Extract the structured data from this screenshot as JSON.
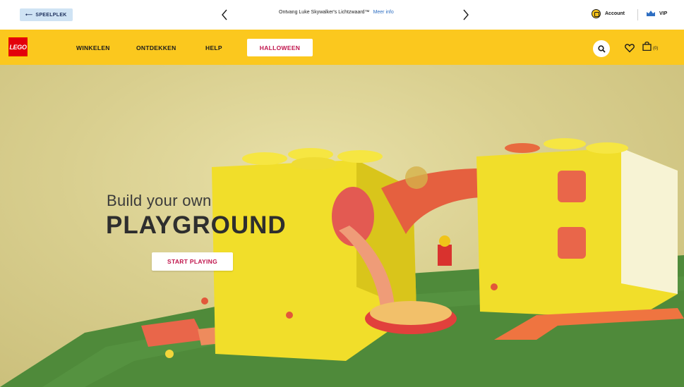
{
  "utility": {
    "speelplek_label": "SPEELPLEK",
    "promo_text": "Ontvang Luke Skywalker's Lichtzwaard™",
    "promo_link": "Meer info",
    "account_label": "Account",
    "vip_label": "VIP"
  },
  "nav": {
    "logo_text": "LEGO",
    "items": [
      "WINKELEN",
      "ONTDEKKEN",
      "HELP"
    ],
    "highlight": "HALLOWEEN",
    "cart_count": "(0)"
  },
  "hero": {
    "subtitle": "Build your own",
    "title": "PLAYGROUND",
    "cta": "START PLAYING"
  },
  "colors": {
    "nav_bg": "#fbc81e",
    "accent_text": "#c0144c",
    "logo_red": "#e3000b",
    "speelplek_bg": "#cfe3f4"
  }
}
